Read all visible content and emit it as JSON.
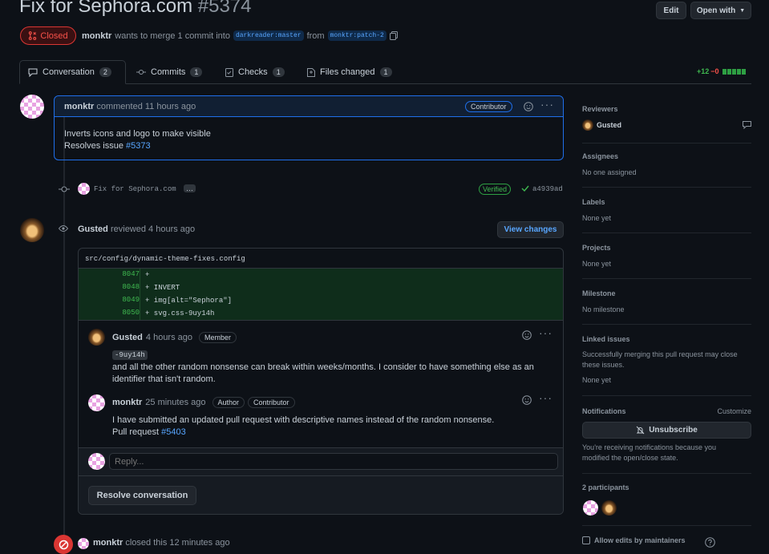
{
  "pr": {
    "title": "Fix for Sephora.com",
    "number": "#5374",
    "state": "Closed",
    "author": "monktr",
    "summary_text": "wants to merge 1 commit into",
    "base_branch": "darkreader:master",
    "from_text": "from",
    "head_branch": "monktr:patch-2",
    "edit_label": "Edit",
    "open_with_label": "Open with"
  },
  "tabs": [
    {
      "label": "Conversation",
      "count": "2"
    },
    {
      "label": "Commits",
      "count": "1"
    },
    {
      "label": "Checks",
      "count": "1"
    },
    {
      "label": "Files changed",
      "count": "1"
    }
  ],
  "diffstat": {
    "added": "+12",
    "removed": "−0"
  },
  "first_comment": {
    "author": "monktr",
    "meta": "commented 11 hours ago",
    "badge": "Contributor",
    "line1": "Inverts icons and logo to make visible",
    "line2_prefix": "Resolves issue",
    "line2_link": "#5373"
  },
  "commit": {
    "message": "Fix for Sephora.com",
    "more": "…",
    "verified": "Verified",
    "sha": "a4939ad"
  },
  "review": {
    "author": "Gusted",
    "meta": "reviewed 4 hours ago",
    "view_changes": "View changes",
    "file": "src/config/dynamic-theme-fixes.config",
    "diff": [
      {
        "ln": "8047",
        "code": "+"
      },
      {
        "ln": "8048",
        "code": "+ INVERT"
      },
      {
        "ln": "8049",
        "code": "+ img[alt=\"Sephora\"]"
      },
      {
        "ln": "8050",
        "code": "+ svg.css-9uy14h"
      }
    ],
    "reply1": {
      "author": "Gusted",
      "time": "4 hours ago",
      "badge": "Member",
      "code": "-9uy14h",
      "text": "and all the other random nonsense can break within weeks/months. I consider to have something else as an identifier that isn't random."
    },
    "reply2": {
      "author": "monktr",
      "time": "25 minutes ago",
      "badge1": "Author",
      "badge2": "Contributor",
      "line1": "I have submitted an updated pull request with descriptive names instead of the random nonsense.",
      "line2_prefix": "Pull request",
      "line2_link": "#5403"
    },
    "reply_placeholder": "Reply...",
    "resolve_label": "Resolve conversation"
  },
  "closed_event": {
    "author": "monktr",
    "text": "closed this 12 minutes ago"
  },
  "sidebar": {
    "reviewers_title": "Reviewers",
    "reviewer": "Gusted",
    "assignees_title": "Assignees",
    "assignees_value": "No one assigned",
    "labels_title": "Labels",
    "labels_value": "None yet",
    "projects_title": "Projects",
    "projects_value": "None yet",
    "milestone_title": "Milestone",
    "milestone_value": "No milestone",
    "linked_title": "Linked issues",
    "linked_desc": "Successfully merging this pull request may close these issues.",
    "linked_value": "None yet",
    "notifications_title": "Notifications",
    "customize": "Customize",
    "unsubscribe": "Unsubscribe",
    "notif_desc": "You're receiving notifications because you modified the open/close state.",
    "participants_title": "2 participants",
    "allow_edits": "Allow edits by maintainers"
  },
  "colors": {
    "accent": "#58a6ff",
    "closed": "#f85149",
    "added": "#3fb950",
    "bg": "#0d1117"
  }
}
